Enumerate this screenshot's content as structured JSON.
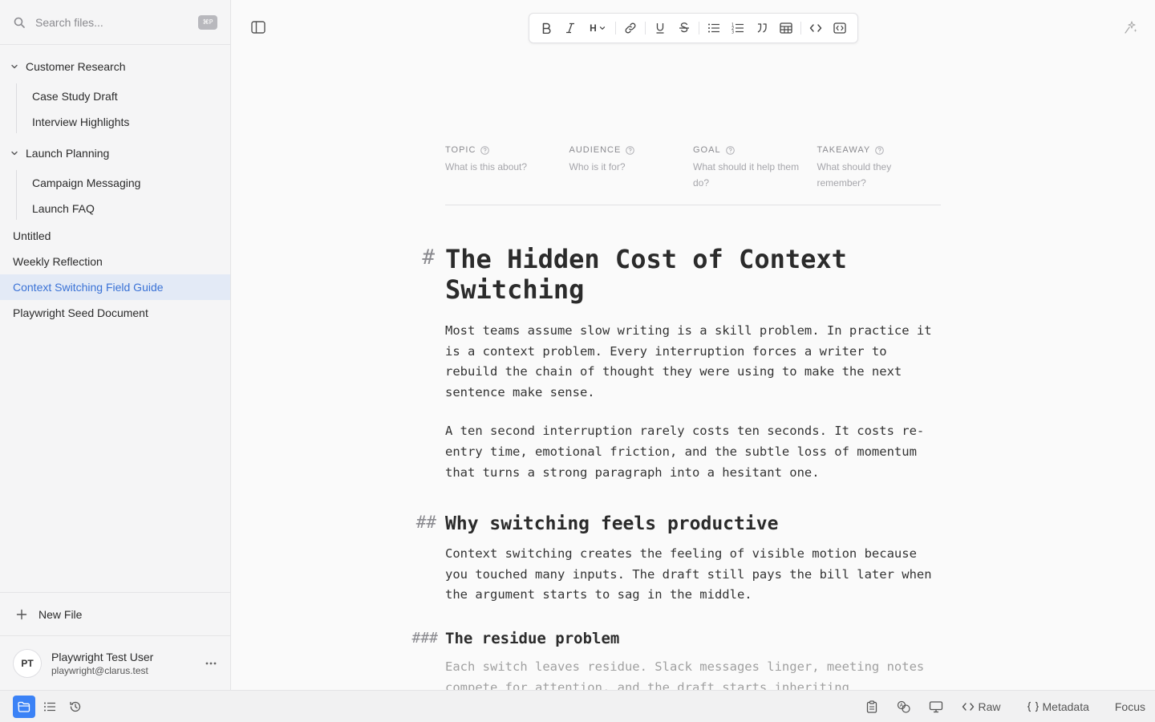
{
  "search": {
    "placeholder": "Search files...",
    "shortcut": "⌘P"
  },
  "sidebar": {
    "folders": [
      {
        "label": "Customer Research",
        "children": [
          "Case Study Draft",
          "Interview Highlights"
        ]
      },
      {
        "label": "Launch Planning",
        "children": [
          "Campaign Messaging",
          "Launch FAQ"
        ]
      }
    ],
    "files": [
      "Untitled",
      "Weekly Reflection",
      "Context Switching Field Guide",
      "Playwright Seed Document"
    ],
    "active_file": "Context Switching Field Guide",
    "new_file_label": "New File"
  },
  "user": {
    "initials": "PT",
    "name": "Playwright Test User",
    "email": "playwright@clarus.test"
  },
  "toolbar": {
    "heading_label": "H"
  },
  "meta_fields": [
    {
      "label": "TOPIC",
      "placeholder": "What is this about?"
    },
    {
      "label": "AUDIENCE",
      "placeholder": "Who is it for?"
    },
    {
      "label": "GOAL",
      "placeholder": "What should it help them do?"
    },
    {
      "label": "TAKEAWAY",
      "placeholder": "What should they remember?"
    }
  ],
  "document": {
    "h1_marker": "#",
    "title": "The Hidden Cost of Context Switching",
    "intro_1": "Most teams assume slow writing is a skill problem. In practice it is a context problem. Every interruption forces a writer to rebuild the chain of thought they were using to make the next sentence make sense.",
    "intro_2": "A ten second interruption rarely costs ten seconds. It costs re-entry time, emotional friction, and the subtle loss of momentum that turns a strong paragraph into a hesitant one.",
    "h2_marker": "##",
    "h2": "Why switching feels productive",
    "h2_body": "Context switching creates the feeling of visible motion because you touched many inputs. The draft still pays the bill later when the argument starts to sag in the middle.",
    "h3_marker": "###",
    "h3": "The residue problem",
    "h3_body": "Each switch leaves residue. Slack messages linger, meeting notes compete for attention, and the draft starts inheriting"
  },
  "statusbar": {
    "raw_label": "Raw",
    "metadata_label": "Metadata",
    "focus_label": "Focus"
  },
  "colors": {
    "accent": "#3b82f6",
    "active_bg": "#e3eaf6",
    "active_text": "#3a72d6"
  }
}
